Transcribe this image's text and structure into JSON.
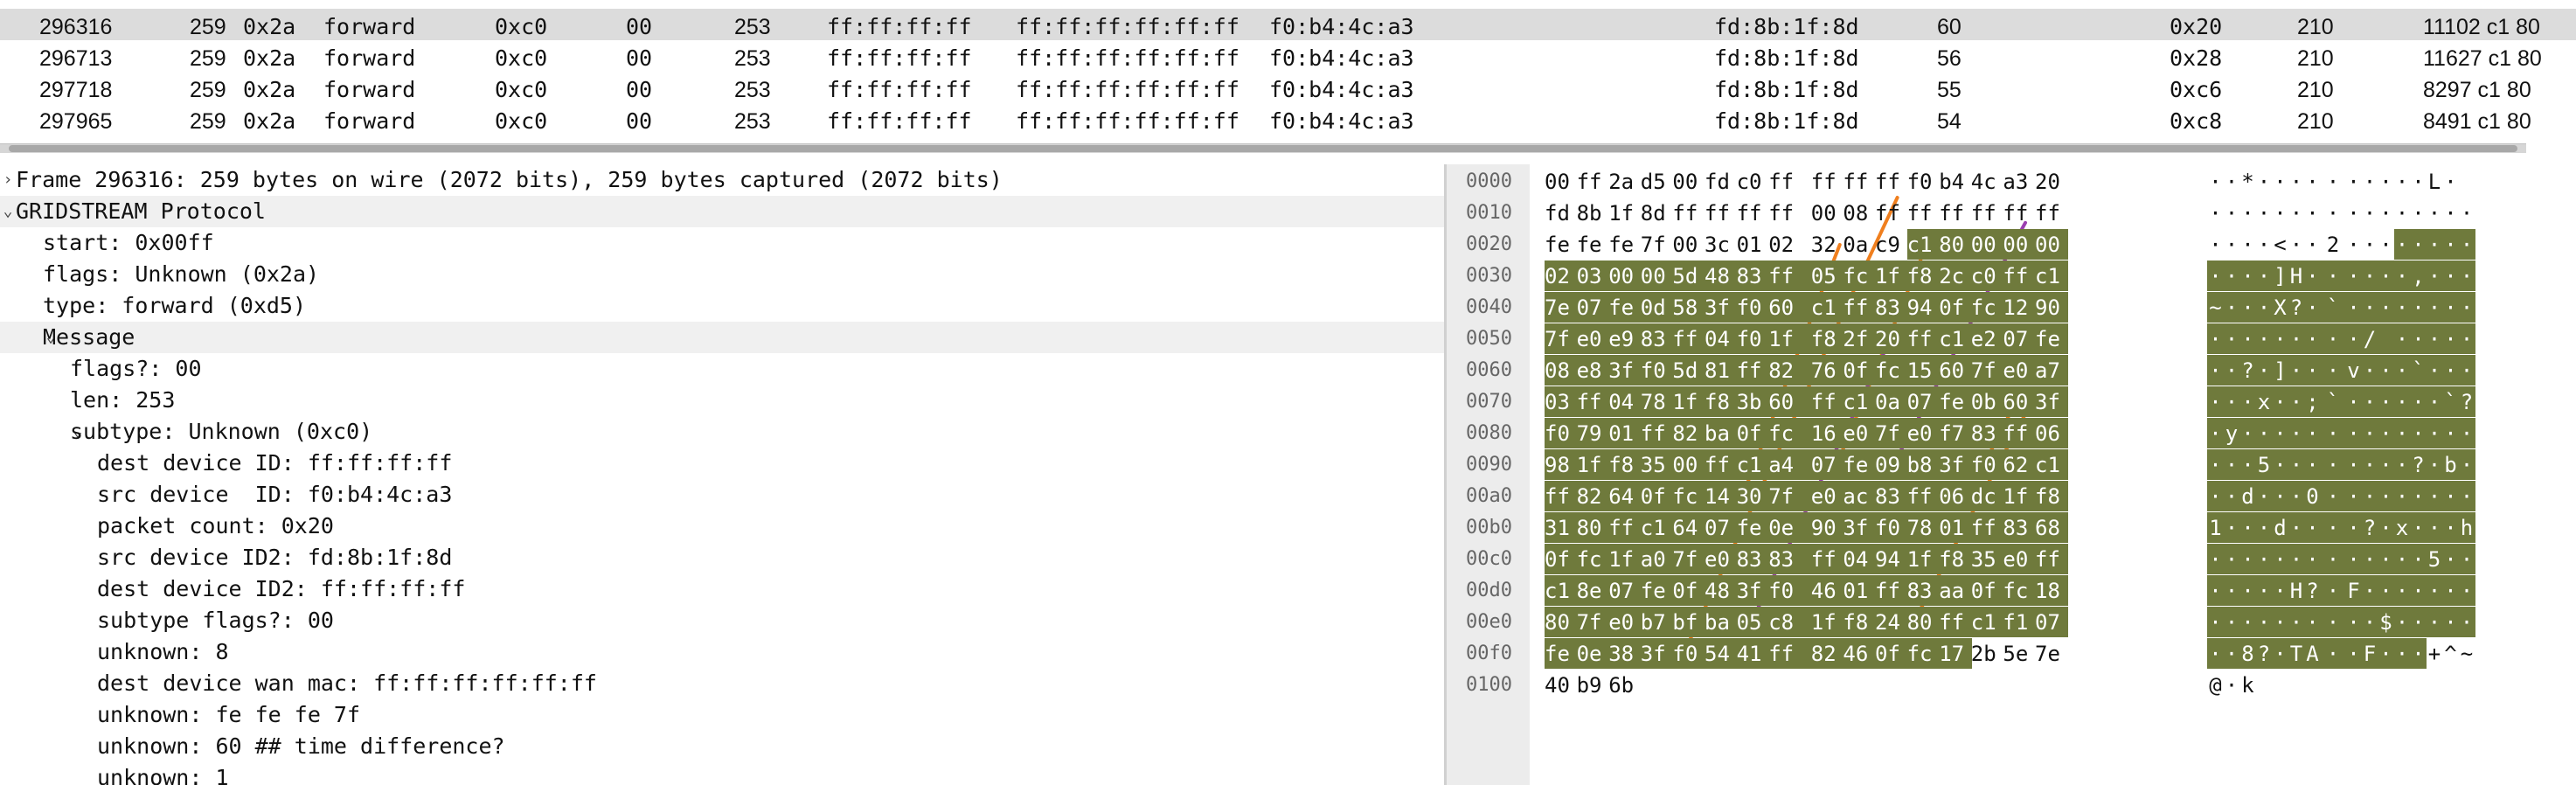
{
  "packet_list": {
    "partial_row": [
      "",
      "",
      "",
      "",
      "",
      "",
      "",
      "",
      "",
      "",
      "",
      "",
      "",
      "",
      "",
      ""
    ],
    "rows": [
      {
        "no": "296316",
        "len": "259",
        "flags": "0x2a",
        "type": "forward",
        "subtype": "0xc0",
        "f2": "00",
        "len2": "253",
        "dest": "ff:ff:ff:ff",
        "wan": "ff:ff:ff:ff:ff:ff",
        "src": "f0:b4:4c:a3",
        "src2": "fd:8b:1f:8d",
        "tdiff": "60",
        "count": "0x20",
        "val": "210",
        "info": "11102 c1 80",
        "selected": true
      },
      {
        "no": "296713",
        "len": "259",
        "flags": "0x2a",
        "type": "forward",
        "subtype": "0xc0",
        "f2": "00",
        "len2": "253",
        "dest": "ff:ff:ff:ff",
        "wan": "ff:ff:ff:ff:ff:ff",
        "src": "f0:b4:4c:a3",
        "src2": "fd:8b:1f:8d",
        "tdiff": "56",
        "count": "0x28",
        "val": "210",
        "info": "11627 c1 80",
        "selected": false
      },
      {
        "no": "297718",
        "len": "259",
        "flags": "0x2a",
        "type": "forward",
        "subtype": "0xc0",
        "f2": "00",
        "len2": "253",
        "dest": "ff:ff:ff:ff",
        "wan": "ff:ff:ff:ff:ff:ff",
        "src": "f0:b4:4c:a3",
        "src2": "fd:8b:1f:8d",
        "tdiff": "55",
        "count": "0xc6",
        "val": "210",
        "info": "8297 c1 80",
        "selected": false
      },
      {
        "no": "297965",
        "len": "259",
        "flags": "0x2a",
        "type": "forward",
        "subtype": "0xc0",
        "f2": "00",
        "len2": "253",
        "dest": "ff:ff:ff:ff",
        "wan": "ff:ff:ff:ff:ff:ff",
        "src": "f0:b4:4c:a3",
        "src2": "fd:8b:1f:8d",
        "tdiff": "54",
        "count": "0xc8",
        "val": "210",
        "info": "8491 c1 80",
        "selected": false
      }
    ]
  },
  "details": {
    "rows": [
      {
        "indent": 0,
        "arrow": "collapsed",
        "text": "Frame 296316: 259 bytes on wire (2072 bits), 259 bytes captured (2072 bits)",
        "hl": false
      },
      {
        "indent": 0,
        "arrow": "expanded",
        "text": "GRIDSTREAM Protocol",
        "hl": true
      },
      {
        "indent": 1,
        "arrow": "none",
        "text": "start: 0x00ff",
        "hl": false
      },
      {
        "indent": 1,
        "arrow": "none",
        "text": "flags: Unknown (0x2a)",
        "hl": false
      },
      {
        "indent": 1,
        "arrow": "none",
        "text": "type: forward (0xd5)",
        "hl": false
      },
      {
        "indent": 1,
        "arrow": "expanded",
        "text": "Message",
        "hl": true
      },
      {
        "indent": 2,
        "arrow": "none",
        "text": "flags?: 00",
        "hl": false
      },
      {
        "indent": 2,
        "arrow": "none",
        "text": "len: 253",
        "hl": false
      },
      {
        "indent": 2,
        "arrow": "expanded",
        "text": "subtype: Unknown (0xc0)",
        "hl": false
      },
      {
        "indent": 3,
        "arrow": "none",
        "text": "dest device ID: ff:ff:ff:ff",
        "hl": false
      },
      {
        "indent": 3,
        "arrow": "none",
        "text": "src device  ID: f0:b4:4c:a3",
        "hl": false
      },
      {
        "indent": 3,
        "arrow": "none",
        "text": "packet count: 0x20",
        "hl": false
      },
      {
        "indent": 3,
        "arrow": "none",
        "text": "src device ID2: fd:8b:1f:8d",
        "hl": false
      },
      {
        "indent": 3,
        "arrow": "none",
        "text": "dest device ID2: ff:ff:ff:ff",
        "hl": false
      },
      {
        "indent": 3,
        "arrow": "none",
        "text": "subtype flags?: 00",
        "hl": false
      },
      {
        "indent": 3,
        "arrow": "none",
        "text": "unknown: 8",
        "hl": false
      },
      {
        "indent": 3,
        "arrow": "none",
        "text": "dest device wan mac: ff:ff:ff:ff:ff:ff",
        "hl": false
      },
      {
        "indent": 3,
        "arrow": "none",
        "text": "unknown: fe fe fe 7f",
        "hl": false
      },
      {
        "indent": 3,
        "arrow": "none",
        "text": "unknown: 60 ## time difference?",
        "hl": false
      },
      {
        "indent": 3,
        "arrow": "none",
        "text": "unknown: 1",
        "hl": false
      }
    ]
  },
  "bytes": {
    "offsets": [
      "0000",
      "0010",
      "0020",
      "0030",
      "0040",
      "0050",
      "0060",
      "0070",
      "0080",
      "0090",
      "00a0",
      "00b0",
      "00c0",
      "00d0",
      "00e0",
      "00f0",
      "0100"
    ],
    "hex": [
      [
        "00",
        "ff",
        "2a",
        "d5",
        "00",
        "fd",
        "c0",
        "ff",
        "ff",
        "ff",
        "ff",
        "f0",
        "b4",
        "4c",
        "a3",
        "20"
      ],
      [
        "fd",
        "8b",
        "1f",
        "8d",
        "ff",
        "ff",
        "ff",
        "ff",
        "00",
        "08",
        "ff",
        "ff",
        "ff",
        "ff",
        "ff",
        "ff"
      ],
      [
        "fe",
        "fe",
        "fe",
        "7f",
        "00",
        "3c",
        "01",
        "02",
        "32",
        "0a",
        "c9",
        "c1",
        "80",
        "00",
        "00",
        "00"
      ],
      [
        "02",
        "03",
        "00",
        "00",
        "5d",
        "48",
        "83",
        "ff",
        "05",
        "fc",
        "1f",
        "f8",
        "2c",
        "c0",
        "ff",
        "c1"
      ],
      [
        "7e",
        "07",
        "fe",
        "0d",
        "58",
        "3f",
        "f0",
        "60",
        "c1",
        "ff",
        "83",
        "94",
        "0f",
        "fc",
        "12",
        "90"
      ],
      [
        "7f",
        "e0",
        "e9",
        "83",
        "ff",
        "04",
        "f0",
        "1f",
        "f8",
        "2f",
        "20",
        "ff",
        "c1",
        "e2",
        "07",
        "fe"
      ],
      [
        "08",
        "e8",
        "3f",
        "f0",
        "5d",
        "81",
        "ff",
        "82",
        "76",
        "0f",
        "fc",
        "15",
        "60",
        "7f",
        "e0",
        "a7"
      ],
      [
        "03",
        "ff",
        "04",
        "78",
        "1f",
        "f8",
        "3b",
        "60",
        "ff",
        "c1",
        "0a",
        "07",
        "fe",
        "0b",
        "60",
        "3f"
      ],
      [
        "f0",
        "79",
        "01",
        "ff",
        "82",
        "ba",
        "0f",
        "fc",
        "16",
        "e0",
        "7f",
        "e0",
        "f7",
        "83",
        "ff",
        "06"
      ],
      [
        "98",
        "1f",
        "f8",
        "35",
        "00",
        "ff",
        "c1",
        "a4",
        "07",
        "fe",
        "09",
        "b8",
        "3f",
        "f0",
        "62",
        "c1"
      ],
      [
        "ff",
        "82",
        "64",
        "0f",
        "fc",
        "14",
        "30",
        "7f",
        "e0",
        "ac",
        "83",
        "ff",
        "06",
        "dc",
        "1f",
        "f8"
      ],
      [
        "31",
        "80",
        "ff",
        "c1",
        "64",
        "07",
        "fe",
        "0e",
        "90",
        "3f",
        "f0",
        "78",
        "01",
        "ff",
        "83",
        "68"
      ],
      [
        "0f",
        "fc",
        "1f",
        "a0",
        "7f",
        "e0",
        "83",
        "83",
        "ff",
        "04",
        "94",
        "1f",
        "f8",
        "35",
        "e0",
        "ff"
      ],
      [
        "c1",
        "8e",
        "07",
        "fe",
        "0f",
        "48",
        "3f",
        "f0",
        "46",
        "01",
        "ff",
        "83",
        "aa",
        "0f",
        "fc",
        "18"
      ],
      [
        "80",
        "7f",
        "e0",
        "b7",
        "bf",
        "ba",
        "05",
        "c8",
        "1f",
        "f8",
        "24",
        "80",
        "ff",
        "c1",
        "f1",
        "07"
      ],
      [
        "fe",
        "0e",
        "38",
        "3f",
        "f0",
        "54",
        "41",
        "ff",
        "82",
        "46",
        "0f",
        "fc",
        "17",
        "2b",
        "5e",
        "7e"
      ],
      [
        "40",
        "b9",
        "6b"
      ]
    ],
    "ascii": [
      [
        "·",
        "·",
        "*",
        "·",
        "·",
        "·",
        "·",
        "·",
        "·",
        "·",
        "·",
        "·",
        "·",
        "L",
        "·",
        " "
      ],
      [
        "·",
        "·",
        "·",
        "·",
        "·",
        "·",
        "·",
        "·",
        "·",
        "·",
        "·",
        "·",
        "·",
        "·",
        "·",
        "·"
      ],
      [
        "·",
        "·",
        "·",
        "·",
        "<",
        "·",
        "·",
        "2",
        "·",
        "·",
        "·",
        "·",
        "·",
        "·",
        "·",
        "·"
      ],
      [
        "·",
        "·",
        "·",
        "·",
        "]",
        "H",
        "·",
        "·",
        "·",
        "·",
        "·",
        "·",
        ",",
        "·",
        "·",
        "·"
      ],
      [
        "~",
        "·",
        "·",
        "·",
        "X",
        "?",
        "·",
        "`",
        "·",
        "·",
        "·",
        "·",
        "·",
        "·",
        "·",
        "·"
      ],
      [
        "·",
        "·",
        "·",
        "·",
        "·",
        "·",
        "·",
        "·",
        "·",
        "/",
        " ",
        "·",
        "·",
        "·",
        "·",
        "·"
      ],
      [
        "·",
        "·",
        "?",
        "·",
        "]",
        "·",
        "·",
        "·",
        "v",
        "·",
        "·",
        "·",
        "`",
        "·",
        "·",
        "·"
      ],
      [
        "·",
        "·",
        "·",
        "x",
        "·",
        "·",
        ";",
        "`",
        "·",
        "·",
        "·",
        "·",
        "·",
        "·",
        "`",
        "?"
      ],
      [
        "·",
        "y",
        "·",
        "·",
        "·",
        "·",
        "·",
        "·",
        "·",
        "·",
        "·",
        "·",
        "·",
        "·",
        "·",
        "·"
      ],
      [
        "·",
        "·",
        "·",
        "5",
        "·",
        "·",
        "·",
        "·",
        "·",
        "·",
        "·",
        "·",
        "?",
        "·",
        "b",
        "·"
      ],
      [
        "·",
        "·",
        "d",
        "·",
        "·",
        "·",
        "0",
        "·",
        "·",
        "·",
        "·",
        "·",
        "·",
        "·",
        "·",
        "·"
      ],
      [
        "1",
        "·",
        "·",
        "·",
        "d",
        "·",
        "·",
        "·",
        "·",
        "?",
        "·",
        "x",
        "·",
        "·",
        "·",
        "h"
      ],
      [
        "·",
        "·",
        "·",
        "·",
        "·",
        "·",
        "·",
        "·",
        "·",
        "·",
        "·",
        "·",
        "·",
        "5",
        "·",
        "·"
      ],
      [
        "·",
        "·",
        "·",
        "·",
        "·",
        "H",
        "?",
        "·",
        "F",
        "·",
        "·",
        "·",
        "·",
        "·",
        "·",
        "·"
      ],
      [
        "·",
        "·",
        "·",
        "·",
        "·",
        "·",
        "·",
        "·",
        "·",
        "·",
        "$",
        "·",
        "·",
        "·",
        "·",
        "·"
      ],
      [
        "·",
        "·",
        "8",
        "?",
        "·",
        "T",
        "A",
        "·",
        "·",
        "F",
        "·",
        "·",
        "·",
        "+",
        "^",
        "~"
      ],
      [
        "@",
        "·",
        "k"
      ]
    ],
    "selection_start_row": 2,
    "selection_start_col": 11,
    "selection_end_row": 15,
    "selection_end_col": 12,
    "highlight_color": "#6f7a3c",
    "annotation_colors": [
      "#f07f1e",
      "#9b3fb0"
    ]
  }
}
